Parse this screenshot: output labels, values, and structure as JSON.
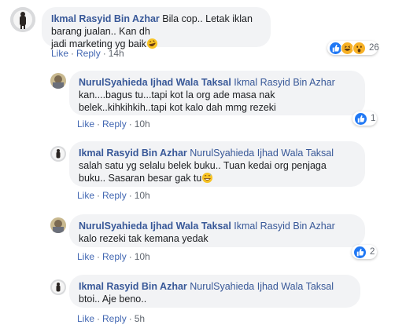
{
  "comments": [
    {
      "name": "Ikmal Rasyid Bin Azhar",
      "mention": "",
      "text1": " Bila cop.. Letak iklan barang jualan.. Kan dh",
      "text2": "jadi marketing yg baik",
      "like": "Like",
      "reply": "Reply",
      "time": "14h",
      "reaction_count": "26"
    },
    {
      "name": "NurulSyahieda Ijhad Wala Taksal",
      "mention": "Ikmal Rasyid Bin Azhar",
      "text1": "kan....bagus tu...tapi kot la org ade masa nak",
      "text2": "belek..kihkihkih..tapi kot kalo dah mmg rezeki",
      "like": "Like",
      "reply": "Reply",
      "time": "10h",
      "reaction_count": "1"
    },
    {
      "name": "Ikmal Rasyid Bin Azhar",
      "mention": "NurulSyahieda Ijhad Wala Taksal",
      "text1": "salah satu yg selalu belek buku.. Tuan kedai org penjaga",
      "text2": "buku.. Sasaran besar gak tu",
      "like": "Like",
      "reply": "Reply",
      "time": "10h"
    },
    {
      "name": "NurulSyahieda Ijhad Wala Taksal",
      "mention": "Ikmal Rasyid Bin Azhar",
      "text1": "kalo rezeki tak kemana yedak",
      "like": "Like",
      "reply": "Reply",
      "time": "10h",
      "reaction_count": "2"
    },
    {
      "name": "Ikmal Rasyid Bin Azhar",
      "mention": "NurulSyahieda Ijhad Wala Taksal",
      "text1": "btoi.. Aje beno..",
      "like": "Like",
      "reply": "Reply",
      "time": "5h"
    }
  ],
  "colors": {
    "name": "#385898",
    "bubble": "#f2f3f5",
    "like_blue": "#2078f4",
    "haha_yellow": "#f7b125"
  },
  "icons": [
    "rofl-emoji-icon",
    "like-reaction-icon",
    "haha-reaction-icon",
    "wow-reaction-icon",
    "grin-sweat-emoji-icon"
  ]
}
